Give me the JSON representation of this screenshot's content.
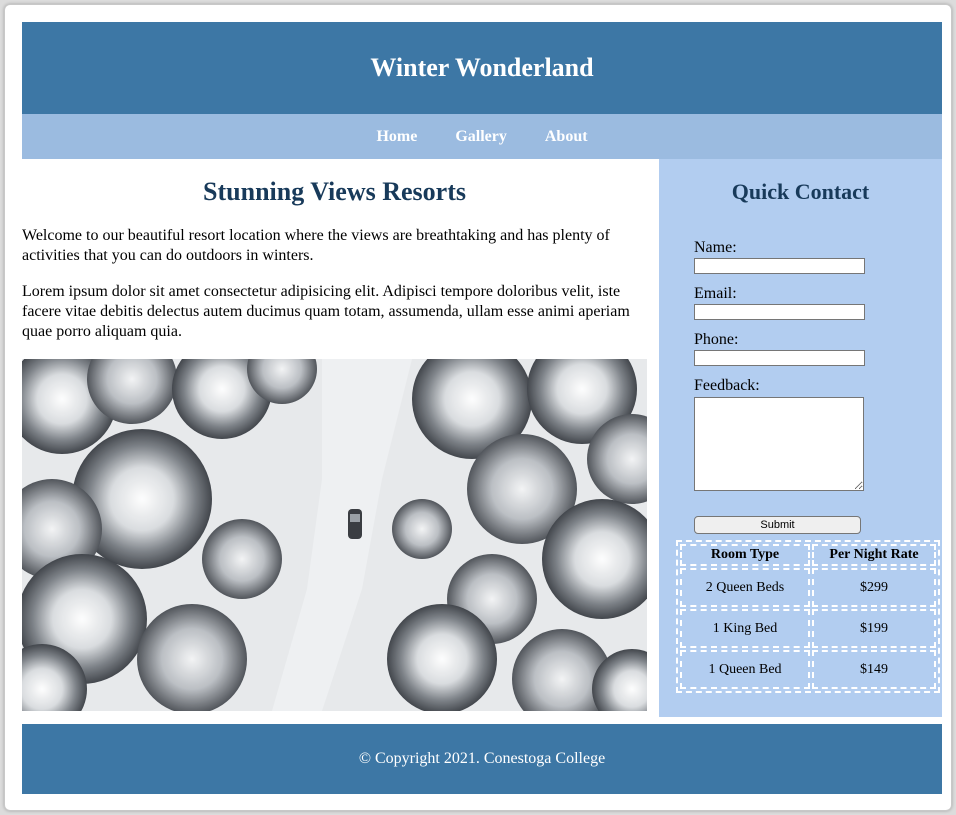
{
  "site": {
    "title": "Winter Wonderland"
  },
  "nav": {
    "items": [
      "Home",
      "Gallery",
      "About"
    ]
  },
  "main": {
    "heading": "Stunning Views Resorts",
    "paragraph1": "Welcome to our beautiful resort location where the views are breathtaking and has plenty of activities that you can do outdoors in winters.",
    "paragraph2": "Lorem ipsum dolor sit amet consectetur adipisicing elit. Adipisci tempore doloribus velit, iste facere vitae debitis delectus autem ducimus quam totam, assumenda, ullam esse animi aperiam quae porro aliquam quia."
  },
  "contact": {
    "heading": "Quick Contact",
    "name_label": "Name:",
    "email_label": "Email:",
    "phone_label": "Phone:",
    "feedback_label": "Feedback:",
    "submit_label": "Submit"
  },
  "rates": {
    "headers": [
      "Room Type",
      "Per Night Rate"
    ],
    "rows": [
      [
        "2 Queen Beds",
        "$299"
      ],
      [
        "1 King Bed",
        "$199"
      ],
      [
        "1 Queen Bed",
        "$149"
      ]
    ]
  },
  "footer": {
    "text": "© Copyright 2021. Conestoga College"
  },
  "colors": {
    "header": "#3d77a5",
    "nav": "#9bbbe0",
    "sidebar": "#b2cdf0",
    "heading": "#183a5a"
  }
}
